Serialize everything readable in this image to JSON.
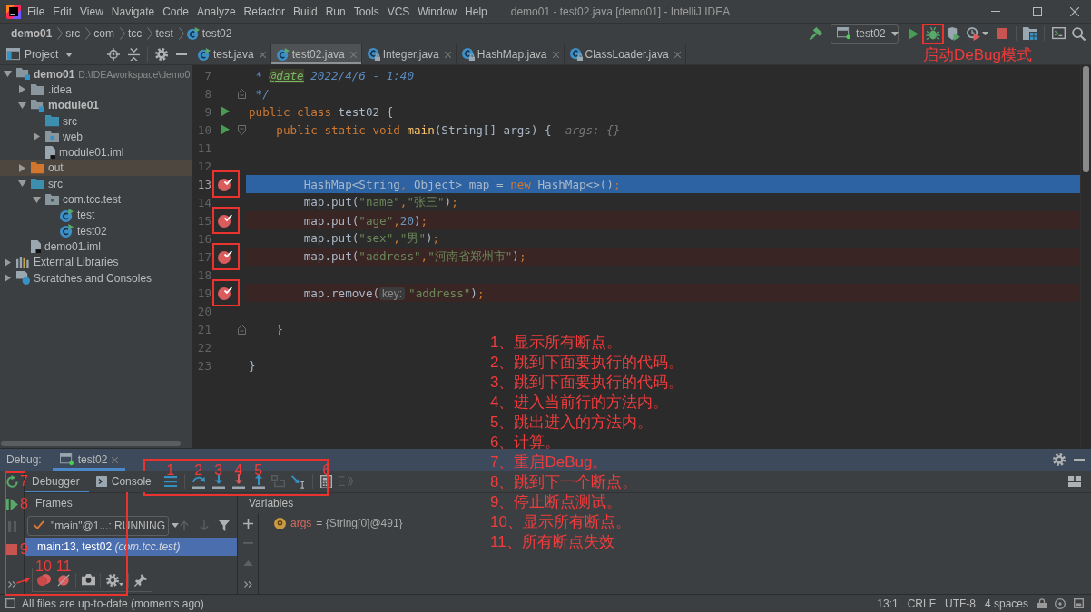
{
  "window": {
    "title": "demo01 - test02.java [demo01] - IntelliJ IDEA"
  },
  "menu": [
    "File",
    "Edit",
    "View",
    "Navigate",
    "Code",
    "Analyze",
    "Refactor",
    "Build",
    "Run",
    "Tools",
    "VCS",
    "Window",
    "Help"
  ],
  "breadcrumbs": [
    {
      "label": "demo01",
      "kind": "project"
    },
    {
      "label": "src",
      "kind": "folder"
    },
    {
      "label": "com",
      "kind": "folder"
    },
    {
      "label": "tcc",
      "kind": "folder"
    },
    {
      "label": "test",
      "kind": "folder"
    },
    {
      "label": "test02",
      "kind": "class"
    }
  ],
  "run_toolbar": {
    "configuration": "test02",
    "debug_callout": "启动DeBug模式"
  },
  "project": {
    "title": "Project",
    "tree": [
      {
        "label": "demo01",
        "kind": "module",
        "path": "D:\\IDEAworkspace\\demo0",
        "expanded": true,
        "selected": false,
        "children": [
          {
            "label": ".idea",
            "kind": "folder",
            "expanded": false,
            "selected": false
          },
          {
            "label": "module01",
            "kind": "module",
            "expanded": true,
            "selected": false,
            "children": [
              {
                "label": "src",
                "kind": "source-folder",
                "selected": false
              },
              {
                "label": "web",
                "kind": "web-folder",
                "expanded": false,
                "selected": false
              },
              {
                "label": "module01.iml",
                "kind": "iml",
                "selected": false
              }
            ]
          },
          {
            "label": "out",
            "kind": "excluded-folder",
            "expanded": false,
            "selected": true
          },
          {
            "label": "src",
            "kind": "source-folder",
            "expanded": true,
            "selected": false,
            "children": [
              {
                "label": "com.tcc.test",
                "kind": "package",
                "expanded": true,
                "selected": false,
                "children": [
                  {
                    "label": "test",
                    "kind": "class",
                    "selected": false
                  },
                  {
                    "label": "test02",
                    "kind": "class",
                    "selected": false
                  }
                ]
              }
            ]
          },
          {
            "label": "demo01.iml",
            "kind": "iml",
            "selected": false
          }
        ]
      },
      {
        "label": "External Libraries",
        "kind": "libraries",
        "expanded": false,
        "selected": false
      },
      {
        "label": "Scratches and Consoles",
        "kind": "scratches",
        "expanded": false,
        "selected": false
      }
    ]
  },
  "editor_tabs": [
    {
      "label": "test.java",
      "kind": "class",
      "selected": false
    },
    {
      "label": "test02.java",
      "kind": "class",
      "selected": true
    },
    {
      "label": "Integer.java",
      "kind": "library-class",
      "selected": false
    },
    {
      "label": "HashMap.java",
      "kind": "library-class",
      "selected": false
    },
    {
      "label": "ClassLoader.java",
      "kind": "library-class",
      "selected": false
    }
  ],
  "editor": {
    "lines": [
      {
        "number": "7",
        "current": false,
        "breakpoint": false,
        "run": false,
        "code": [
          {
            "kind": "comment",
            "text": " * "
          },
          {
            "kind": "doc-tag",
            "text": "@date"
          },
          {
            "kind": "comment",
            "text": " 2022/4/6 - 1:40"
          }
        ]
      },
      {
        "number": "8",
        "current": false,
        "breakpoint": false,
        "run": false,
        "fold_end": true,
        "code": [
          {
            "kind": "comment",
            "text": " */"
          }
        ]
      },
      {
        "number": "9",
        "current": false,
        "breakpoint": false,
        "run": true,
        "code": [
          {
            "kind": "keyword",
            "text": "public class "
          },
          {
            "kind": "plain",
            "text": "test02 {"
          }
        ]
      },
      {
        "number": "10",
        "current": false,
        "breakpoint": false,
        "run": true,
        "fold_start": true,
        "code": [
          {
            "kind": "keyword",
            "text": "    public static void "
          },
          {
            "kind": "method",
            "text": "main"
          },
          {
            "kind": "plain",
            "text": "(String[] args) {"
          },
          {
            "kind": "hint",
            "text": "args: {}"
          }
        ]
      },
      {
        "number": "11",
        "current": false,
        "breakpoint": false,
        "run": false
      },
      {
        "number": "12",
        "current": false,
        "breakpoint": false,
        "run": false
      },
      {
        "number": "13",
        "current": true,
        "breakpoint": true,
        "run": false,
        "code": [
          {
            "kind": "plain",
            "text": "        HashMap<String"
          },
          {
            "kind": "keyword",
            "text": ","
          },
          {
            "kind": "plain",
            "text": " Object> map = "
          },
          {
            "kind": "keyword",
            "text": "new"
          },
          {
            "kind": "plain",
            "text": " HashMap<>()"
          },
          {
            "kind": "keyword",
            "text": ";"
          }
        ]
      },
      {
        "number": "14",
        "current": false,
        "breakpoint": false,
        "run": false,
        "code": [
          {
            "kind": "plain",
            "text": "        map.put("
          },
          {
            "kind": "string",
            "text": "\"name\""
          },
          {
            "kind": "keyword",
            "text": ","
          },
          {
            "kind": "string",
            "text": "\"张三\""
          },
          {
            "kind": "plain",
            "text": ")"
          },
          {
            "kind": "keyword",
            "text": ";"
          }
        ]
      },
      {
        "number": "15",
        "current": false,
        "breakpoint": true,
        "run": false,
        "code": [
          {
            "kind": "plain",
            "text": "        map.put("
          },
          {
            "kind": "string",
            "text": "\"age\""
          },
          {
            "kind": "keyword",
            "text": ","
          },
          {
            "kind": "number",
            "text": "20"
          },
          {
            "kind": "plain",
            "text": ")"
          },
          {
            "kind": "keyword",
            "text": ";"
          }
        ]
      },
      {
        "number": "16",
        "current": false,
        "breakpoint": false,
        "run": false,
        "code": [
          {
            "kind": "plain",
            "text": "        map.put("
          },
          {
            "kind": "string",
            "text": "\"sex\""
          },
          {
            "kind": "keyword",
            "text": ","
          },
          {
            "kind": "string",
            "text": "\"男\""
          },
          {
            "kind": "plain",
            "text": ")"
          },
          {
            "kind": "keyword",
            "text": ";"
          }
        ]
      },
      {
        "number": "17",
        "current": false,
        "breakpoint": true,
        "run": false,
        "code": [
          {
            "kind": "plain",
            "text": "        map.put("
          },
          {
            "kind": "string",
            "text": "\"address\""
          },
          {
            "kind": "keyword",
            "text": ","
          },
          {
            "kind": "string",
            "text": "\"河南省郑州市\""
          },
          {
            "kind": "plain",
            "text": ")"
          },
          {
            "kind": "keyword",
            "text": ";"
          }
        ]
      },
      {
        "number": "18",
        "current": false,
        "breakpoint": false,
        "run": false
      },
      {
        "number": "19",
        "current": false,
        "breakpoint": true,
        "run": false,
        "code": [
          {
            "kind": "plain",
            "text": "        map.remove("
          },
          {
            "kind": "param-hint",
            "text": "key:"
          },
          {
            "kind": "string",
            "text": "\"address\""
          },
          {
            "kind": "plain",
            "text": ")"
          },
          {
            "kind": "keyword",
            "text": ";"
          }
        ]
      },
      {
        "number": "20",
        "current": false,
        "breakpoint": false,
        "run": false
      },
      {
        "number": "21",
        "current": false,
        "breakpoint": false,
        "run": false,
        "fold_end": true,
        "code": [
          {
            "kind": "plain",
            "text": "    }"
          }
        ]
      },
      {
        "number": "22",
        "current": false,
        "breakpoint": false,
        "run": false
      },
      {
        "number": "23",
        "current": false,
        "breakpoint": false,
        "run": false,
        "code": [
          {
            "kind": "plain",
            "text": "}"
          }
        ]
      }
    ]
  },
  "annotations": {
    "notes": [
      "1、显示所有断点。",
      "2、跳到下面要执行的代码。",
      "3、跳到下面要执行的代码。",
      "4、进入当前行的方法内。",
      "5、跳出进入的方法内。",
      "6、计算。",
      "7、重启DeBug。",
      "8、跳到下一个断点。",
      "9、停止断点测试。",
      "10、显示所有断点。",
      "11、所有断点失效"
    ]
  },
  "debug": {
    "title": "Debug:",
    "session": {
      "label": "test02",
      "selected": true
    },
    "side_toolbar": [
      {
        "kind": "rerun",
        "marker": "7",
        "disabled": false
      },
      {
        "kind": "resume",
        "marker": "8",
        "disabled": false
      },
      {
        "kind": "pause",
        "disabled": true
      },
      {
        "kind": "stop",
        "marker": "9",
        "disabled": false
      },
      {
        "kind": "more",
        "disabled": false
      }
    ],
    "tabs": [
      {
        "label": "Debugger",
        "kind": "debugger",
        "selected": true
      },
      {
        "label": "Console",
        "kind": "console",
        "selected": false
      }
    ],
    "stepping_toolbar": [
      {
        "kind": "show-execution-point",
        "marker": "1",
        "disabled": false
      },
      {
        "kind": "step-over",
        "marker": "2",
        "disabled": false
      },
      {
        "kind": "step-into",
        "marker": "3",
        "disabled": false
      },
      {
        "kind": "force-step-into",
        "marker": "4",
        "disabled": false
      },
      {
        "kind": "step-out",
        "marker": "5",
        "disabled": false
      },
      {
        "kind": "drop-frame",
        "disabled": true
      },
      {
        "kind": "run-to-cursor",
        "disabled": false
      },
      {
        "kind": "evaluate",
        "marker": "6",
        "disabled": false
      },
      {
        "kind": "trace",
        "disabled": true
      }
    ],
    "frames": {
      "title": "Frames",
      "thread": "\"main\"@1...: RUNNING",
      "items": [
        {
          "text": "main:13, test02 *(com.tcc.test)*",
          "selected": true
        }
      ]
    },
    "variables": {
      "title": "Variables",
      "items": [
        {
          "name": "args",
          "value": "= {String[0]@491}"
        }
      ]
    },
    "breakpoint_toolbar": [
      {
        "kind": "view-breakpoints",
        "marker": "10"
      },
      {
        "kind": "mute-breakpoints",
        "marker": "11"
      },
      {
        "kind": "snapshot"
      },
      {
        "kind": "settings"
      },
      {
        "kind": "pin"
      }
    ]
  },
  "status_bar": {
    "message": "All files are up-to-date (moments ago)",
    "caret_position": "13:1",
    "line_separator": "CRLF",
    "encoding": "UTF-8",
    "indent": "4 spaces"
  }
}
